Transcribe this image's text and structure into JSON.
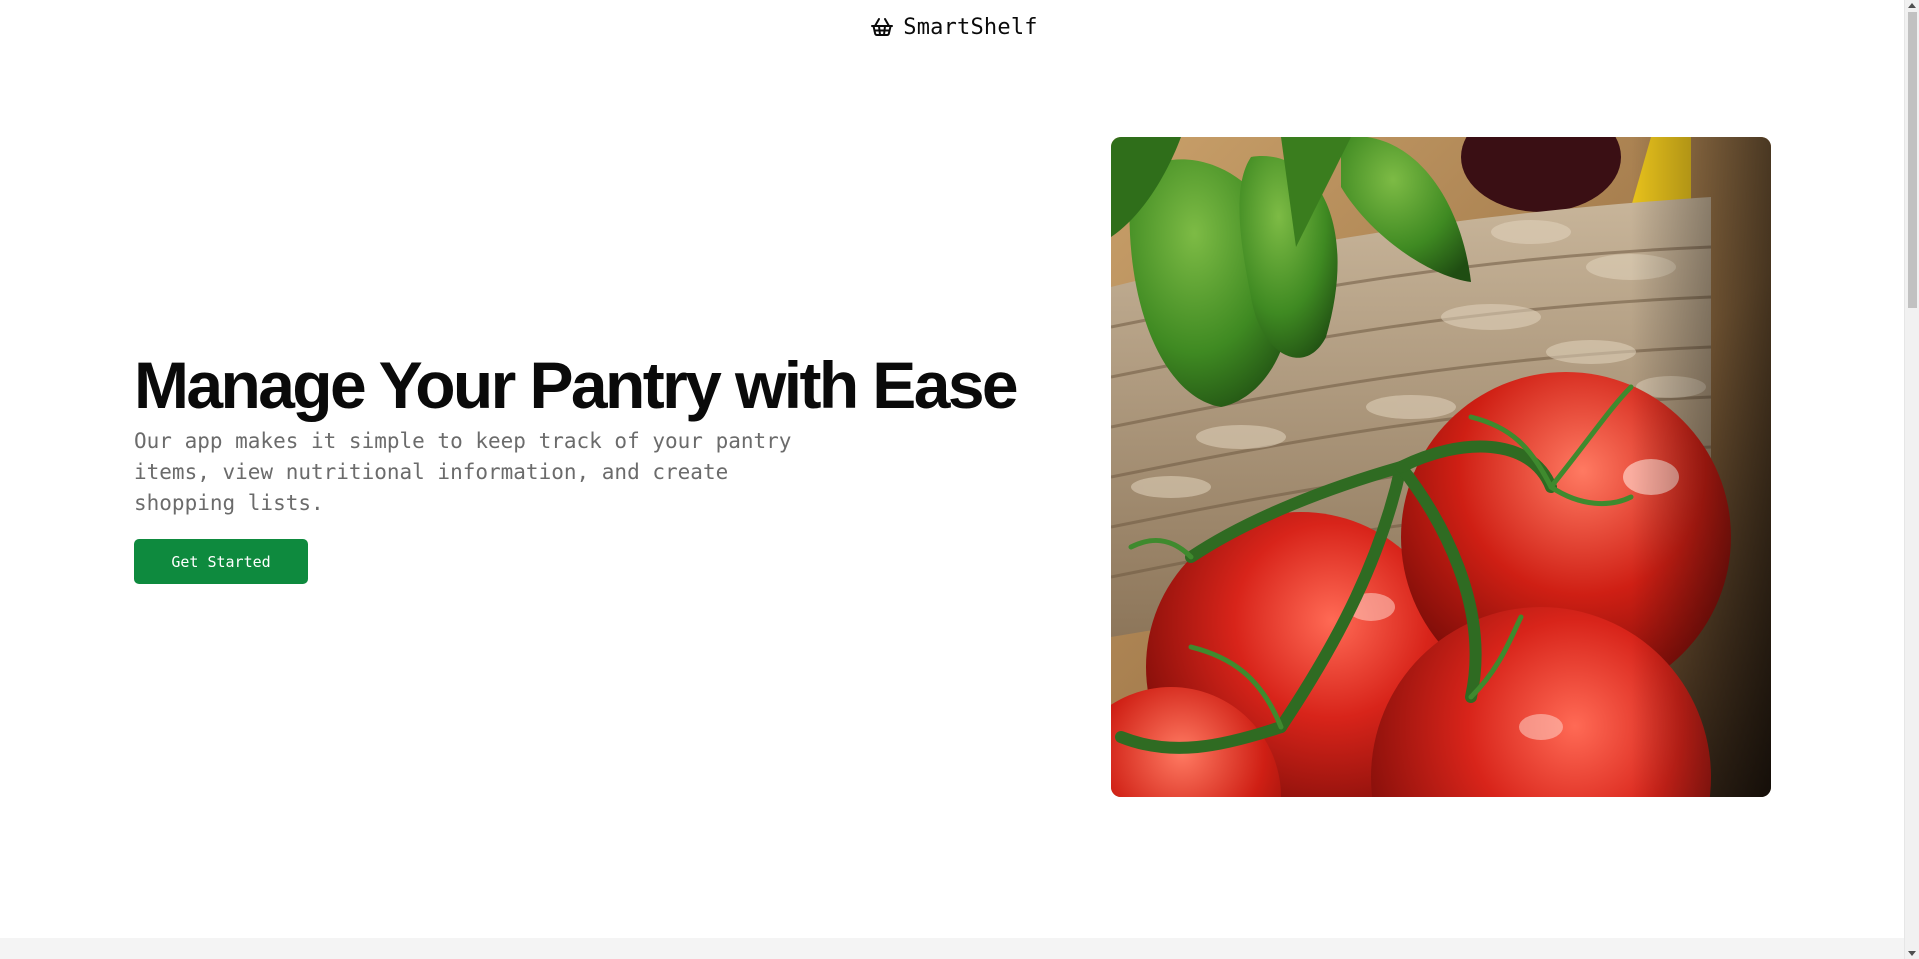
{
  "header": {
    "brand_name": "SmartShelf",
    "brand_icon": "basket-icon"
  },
  "hero": {
    "title": "Manage Your Pantry with Ease",
    "subtitle": "Our app makes it simple to keep track of your pantry items, view nutritional information, and create shopping lists.",
    "cta_label": "Get Started",
    "image_subject": "tomatoes-on-vine-in-wicker-basket-with-basil"
  },
  "colors": {
    "accent": "#0e8a3e",
    "text": "#0a0a0a",
    "muted_text": "#6b6b6b",
    "background": "#ffffff",
    "footer_strip": "#f4f4f4"
  }
}
